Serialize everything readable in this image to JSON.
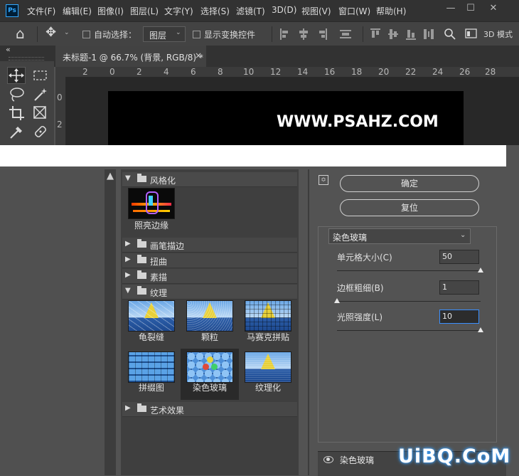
{
  "app": {
    "logo": "Ps"
  },
  "menu": [
    "文件(F)",
    "编辑(E)",
    "图像(I)",
    "图层(L)",
    "文字(Y)",
    "选择(S)",
    "滤镜(T)",
    "3D(D)",
    "视图(V)",
    "窗口(W)",
    "帮助(H)"
  ],
  "window_controls": {
    "minimize": "—",
    "maximize": "☐",
    "close": "✕"
  },
  "options_bar": {
    "home_icon": "⌂",
    "move_icon": "✥",
    "auto_select_label": "自动选择：",
    "auto_select_value": "图层",
    "show_transform_label": "显示变换控件",
    "mode_3d_label": "3D 模式"
  },
  "document_tab": {
    "title": "未标题-1 @ 66.7% (背景, RGB/8) *",
    "close": "×"
  },
  "panel_collapse": "«",
  "ruler": {
    "h_ticks": [
      "2",
      "0",
      "2",
      "4",
      "6",
      "8",
      "10",
      "12",
      "14",
      "16",
      "18",
      "20",
      "22",
      "24",
      "26",
      "28"
    ],
    "v_ticks": [
      "0",
      "2"
    ]
  },
  "canvas_text": "WWW.PSAHZ.COM",
  "filter_gallery": {
    "categories": {
      "stylize": "风格化",
      "brush_strokes": "画笔描边",
      "distort": "扭曲",
      "sketch": "素描",
      "texture": "纹理",
      "artistic": "艺术效果"
    },
    "stylize_filters": [
      "照亮边缘"
    ],
    "texture_filters": [
      "龟裂缝",
      "颗粒",
      "马赛克拼贴",
      "拼缀图",
      "染色玻璃",
      "纹理化"
    ]
  },
  "buttons": {
    "ok": "确定",
    "reset": "复位"
  },
  "filter_select": {
    "value": "染色玻璃"
  },
  "params": {
    "cell_size": {
      "label": "单元格大小(C)",
      "value": "50",
      "level": 1.0
    },
    "border_thickness": {
      "label": "边框粗细(B)",
      "value": "1",
      "level": 0.0
    },
    "light_intensity": {
      "label": "光照强度(L)",
      "value": "10",
      "level": 1.0
    }
  },
  "effect_layer": {
    "name": "染色玻璃"
  },
  "watermark": "UiBQ.CoM"
}
